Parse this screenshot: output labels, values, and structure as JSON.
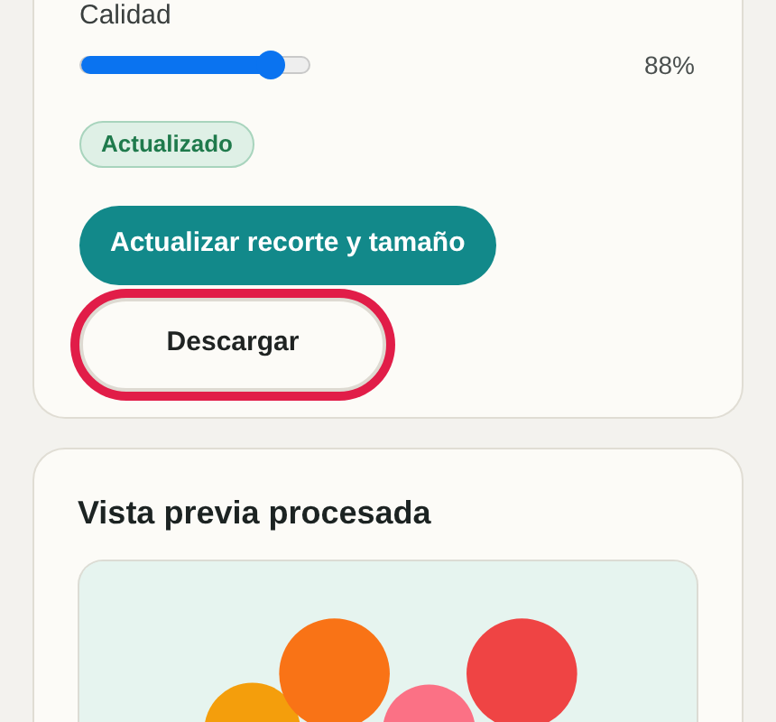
{
  "settings_card": {
    "quality": {
      "label": "Calidad",
      "level": 0.83,
      "reading": "88%"
    },
    "status_badge": "Actualizado",
    "update_button": "Actualizar recorte y tamaño",
    "download_button": {
      "label": "Descargar",
      "focused": true
    }
  },
  "preview_card": {
    "title": "Vista previa procesada"
  }
}
